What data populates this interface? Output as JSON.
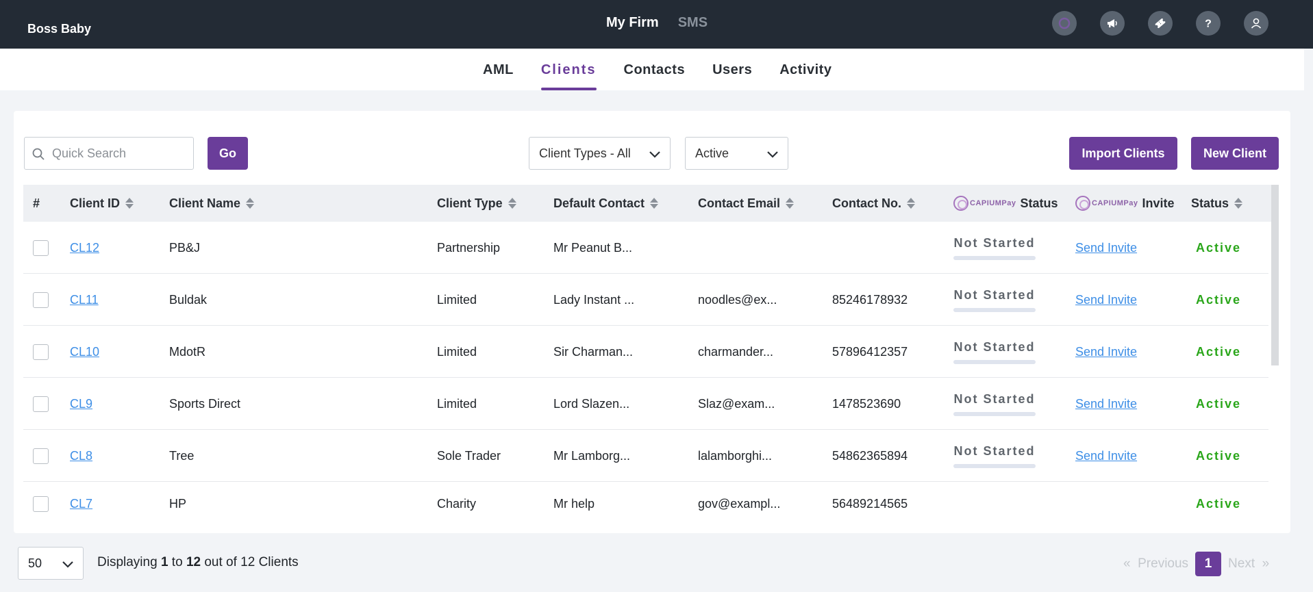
{
  "app": {
    "brand": "Boss Baby"
  },
  "topnav": {
    "items": [
      "My Firm",
      "SMS"
    ]
  },
  "top_icons": [
    "capium-icon",
    "megaphone-icon",
    "ticket-icon",
    "help-icon",
    "user-icon"
  ],
  "subnav": {
    "tabs": [
      "AML",
      "Clients",
      "Contacts",
      "Users",
      "Activity"
    ],
    "active": "Clients"
  },
  "toolbar": {
    "search_placeholder": "Quick Search",
    "go_label": "Go",
    "client_types_value": "Client Types - All",
    "status_value": "Active",
    "import_label": "Import Clients",
    "new_label": "New Client"
  },
  "table": {
    "headers": {
      "num": "#",
      "client_id": "Client ID",
      "client_name": "Client Name",
      "client_type": "Client Type",
      "default_contact": "Default Contact",
      "contact_email": "Contact Email",
      "contact_no": "Contact No.",
      "capium_word": "CAPIUMPay",
      "pay_status": "Status",
      "pay_invite": "Invite",
      "status": "Status"
    },
    "rows": [
      {
        "id": "CL12",
        "name": "PB&J",
        "type": "Partnership",
        "contact": "Mr Peanut B...",
        "email": "",
        "phone": "",
        "pay_status": "Not Started",
        "invite": "Send Invite",
        "status": "Active"
      },
      {
        "id": "CL11",
        "name": "Buldak",
        "type": "Limited",
        "contact": "Lady Instant ...",
        "email": "noodles@ex...",
        "phone": "85246178932",
        "pay_status": "Not Started",
        "invite": "Send Invite",
        "status": "Active"
      },
      {
        "id": "CL10",
        "name": "MdotR",
        "type": "Limited",
        "contact": "Sir Charman...",
        "email": "charmander...",
        "phone": "57896412357",
        "pay_status": "Not Started",
        "invite": "Send Invite",
        "status": "Active"
      },
      {
        "id": "CL9",
        "name": "Sports Direct",
        "type": "Limited",
        "contact": "Lord Slazen...",
        "email": "Slaz@exam...",
        "phone": "1478523690",
        "pay_status": "Not Started",
        "invite": "Send Invite",
        "status": "Active"
      },
      {
        "id": "CL8",
        "name": "Tree",
        "type": "Sole Trader",
        "contact": "Mr Lamborg...",
        "email": "lalamborghi...",
        "phone": "54862365894",
        "pay_status": "Not Started",
        "invite": "Send Invite",
        "status": "Active"
      },
      {
        "id": "CL7",
        "name": "HP",
        "type": "Charity",
        "contact": "Mr help",
        "email": "gov@exampl...",
        "phone": "56489214565",
        "pay_status": "",
        "invite": "",
        "status": "Active"
      }
    ]
  },
  "footer": {
    "page_size": "50",
    "displaying_prefix": "Displaying",
    "from": "1",
    "to_word": "to",
    "to": "12",
    "out_of": "out of 12 Clients",
    "prev_label": "Previous",
    "current_page": "1",
    "next_label": "Next"
  }
}
